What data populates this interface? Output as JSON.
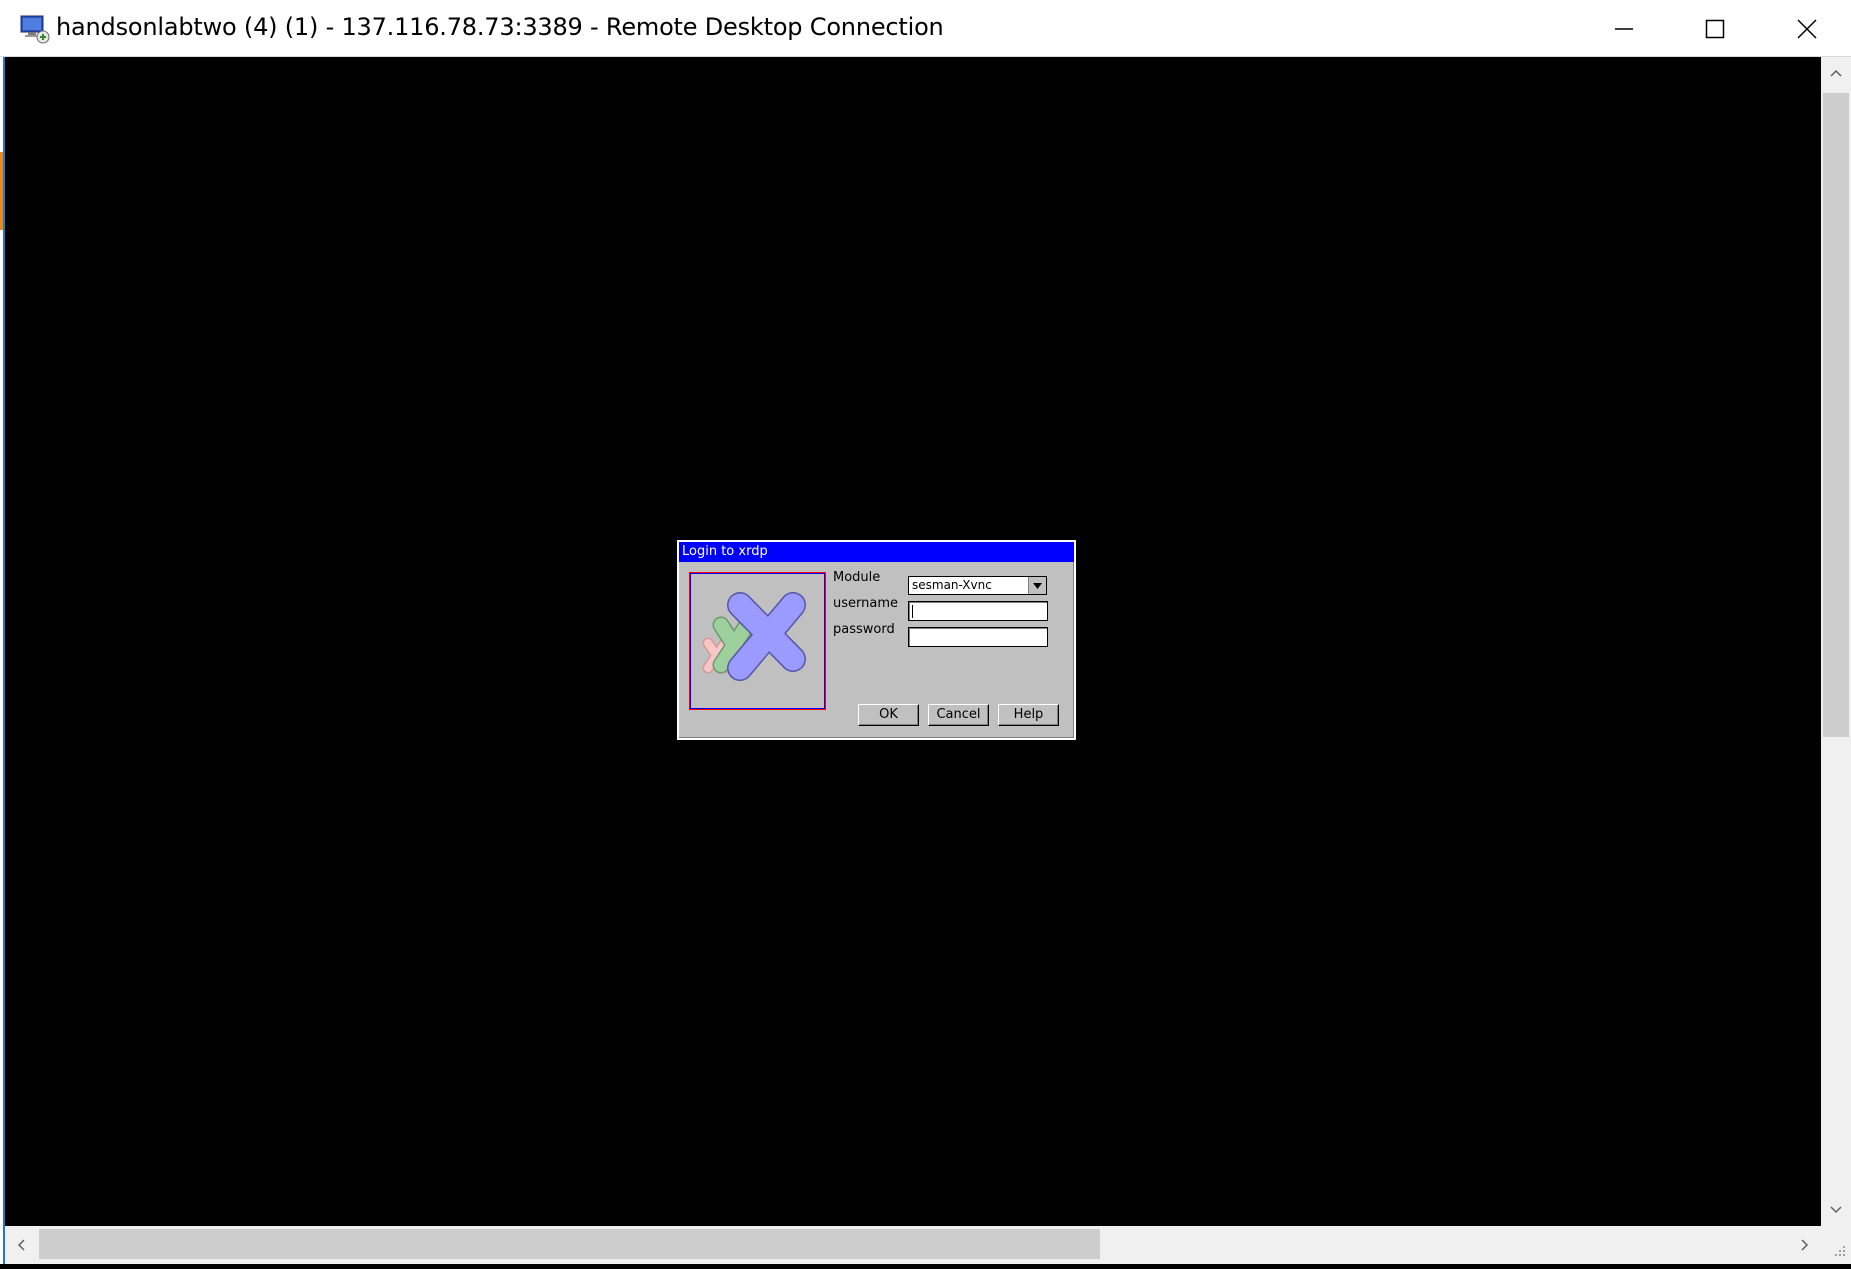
{
  "window": {
    "title": "handsonlabtwo (4) (1) - 137.116.78.73:3389 - Remote Desktop Connection",
    "app_icon": "remote-desktop-icon",
    "controls": {
      "minimize_icon": "minimize-icon",
      "maximize_icon": "maximize-icon",
      "close_icon": "close-icon"
    }
  },
  "login_dialog": {
    "title": "Login to xrdp",
    "logo": "xrdp-logo",
    "module_label": "Module",
    "module_value": "sesman-Xvnc",
    "username_label": "username",
    "username_value": "",
    "password_label": "password",
    "password_value": "",
    "ok_label": "OK",
    "cancel_label": "Cancel",
    "help_label": "Help"
  },
  "colors": {
    "dialog_title_bar": "#0000ff",
    "dialog_background": "#c0c0c0",
    "remote_background": "#000000"
  }
}
